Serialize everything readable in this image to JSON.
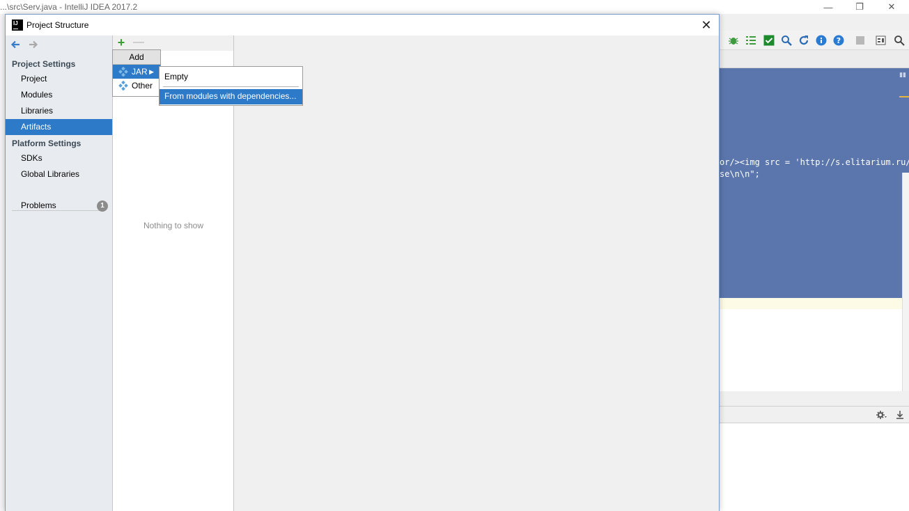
{
  "ide": {
    "title": "...\\src\\Serv.java - IntelliJ IDEA 2017.2",
    "window_controls": {
      "minimize": "—",
      "restore": "❐",
      "close": "✕"
    },
    "toolbar_icons": [
      "bug-icon",
      "list-icon",
      "check-icon",
      "find-icon",
      "refresh-icon",
      "info-icon",
      "help-icon",
      "stop-icon",
      "structure-icon",
      "search-icon"
    ],
    "code_lines": [
      "or/><img src = 'http://s.elitarium.ru/wp",
      "se\\n\\n\";"
    ],
    "console_toolbar_icons": [
      "settings-icon",
      "download-icon"
    ]
  },
  "dialog": {
    "title": "Project Structure",
    "close_glyph": "✕",
    "nav": {
      "back_glyph": "🡐",
      "forward_glyph": "🡒",
      "project_settings_label": "Project Settings",
      "project_settings_items": [
        "Project",
        "Modules",
        "Libraries",
        "Artifacts"
      ],
      "platform_settings_label": "Platform Settings",
      "platform_settings_items": [
        "SDKs",
        "Global Libraries"
      ],
      "problems_label": "Problems",
      "problems_count": "1",
      "selected_item": "Artifacts"
    },
    "list": {
      "add_glyph": "+",
      "remove_glyph": "—",
      "empty_text": "Nothing to show"
    },
    "add_popup": {
      "header": "Add",
      "items": [
        "JAR",
        "Other"
      ],
      "selected": "JAR"
    },
    "jar_submenu": {
      "items": [
        "Empty",
        "From modules with dependencies..."
      ],
      "selected": "From modules with dependencies..."
    }
  },
  "colors": {
    "selection": "#2d7ac9",
    "editor_bg": "#5b76ad",
    "nav_bg": "#e8ebef",
    "add_icon": "#3a9c35"
  }
}
